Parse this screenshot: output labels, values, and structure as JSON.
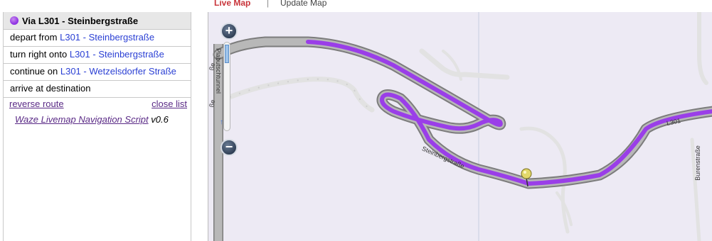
{
  "tabs": {
    "live_map": "Live Map",
    "separator": "|",
    "update_map": "Update Map"
  },
  "route": {
    "title": "Via L301 - Steinbergstraße",
    "color": "#8a2be2",
    "steps": [
      {
        "action": "depart from",
        "road": "L301 - Steinbergstraße"
      },
      {
        "action": "turn right onto",
        "road": "L301 - Steinbergstraße"
      },
      {
        "action": "continue on",
        "road": "L301 - Wetzelsdorfer Straße"
      },
      {
        "action": "arrive at destination",
        "road": ""
      }
    ],
    "reverse_label": "reverse route",
    "close_label": "close list",
    "credit_link": "Waze Livemap Navigation Script",
    "credit_version": "v0.6"
  },
  "map": {
    "zoom_in": "+",
    "zoom_out": "−",
    "labels": {
      "plabutsch": "Plabutschtunnel",
      "steinberg": "Steinbergstraße",
      "l301": "L301",
      "buren": "Burenstraße",
      "edge1": "ße",
      "edge2": "ße"
    },
    "colors": {
      "road_fill": "#b8b8b8",
      "road_outline": "#7c7c7c",
      "minor_road": "#e0e0e0",
      "background": "#edeaf4"
    }
  }
}
